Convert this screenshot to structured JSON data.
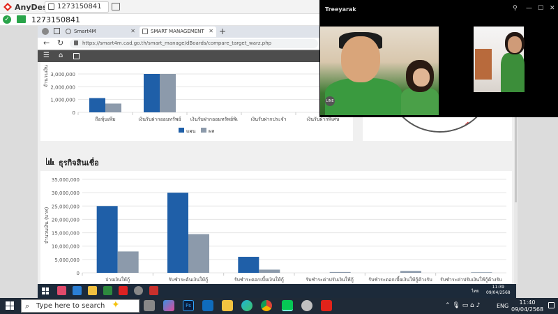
{
  "anydesk": {
    "app_name": "AnyDesk",
    "tab_label": "1273150841",
    "address_value": "1273150841"
  },
  "browser": {
    "tabs": [
      {
        "label": "Smart4M",
        "active": false
      },
      {
        "label": "SMART MANAGEMENT",
        "active": true
      }
    ],
    "url": "https://smart4m.cad.go.th/smart_manage/dBoards/compare_target_warz.php"
  },
  "section": {
    "title": "ธุรกิจสินเชื่อ"
  },
  "video": {
    "title": "Treeyarak",
    "badge": "LINE"
  },
  "remote_taskbar": {
    "lang": "ไทย",
    "time": "11:39",
    "date": "09/04/2568"
  },
  "taskbar": {
    "search_placeholder": "Type here to search",
    "lang": "ENG",
    "time": "11:40",
    "date": "09/04/2568"
  },
  "colors": {
    "plan": "#1f5fa8",
    "result": "#8c9aab",
    "anydesk_red": "#e2231a"
  },
  "chart_data": [
    {
      "type": "bar",
      "ylabel": "จำนวนเงิน",
      "yticks": [
        "0",
        "1,000,000",
        "2,000,000",
        "3,000,000"
      ],
      "ylim": [
        0,
        3500000
      ],
      "categories": [
        "ถือหุ้นเพิ่ม",
        "เงินรับฝากออมทรัพย์",
        "เงินรับฝากออมทรัพย์พิเ",
        "เงินรับฝากประจำ",
        "เงินรับฝากพิเศษ"
      ],
      "series": [
        {
          "name": "แผน",
          "values": [
            1300000,
            3500000,
            0,
            0,
            0
          ]
        },
        {
          "name": "ผล",
          "values": [
            800000,
            3500000,
            0,
            0,
            0
          ]
        }
      ],
      "legend": "bottom-center"
    },
    {
      "type": "bar",
      "ylabel": "จำนวนเงิน (บาท)",
      "yticks": [
        "0",
        "5,000,000",
        "10,000,000",
        "15,000,000",
        "20,000,000",
        "25,000,000",
        "30,000,000",
        "35,000,000"
      ],
      "ylim": [
        0,
        35000000
      ],
      "categories": [
        "จ่ายเงินให้กู้",
        "รับชำระต้นเงินให้กู้",
        "รับชำระดอกเบี้ยเงินให้กู้",
        "รับชำระค่าปรับเงินให้กู้",
        "รับชำระดอกเบี้ยเงินให้กู้ค้างรับ",
        "รับชำระค่าปรับเงินให้กู้ค้างรับ"
      ],
      "series": [
        {
          "name": "แผน",
          "values": [
            25000000,
            30000000,
            6000000,
            0,
            0,
            0
          ]
        },
        {
          "name": "ผล",
          "values": [
            8000000,
            14500000,
            1200000,
            300000,
            700000,
            200000
          ]
        }
      ]
    }
  ]
}
